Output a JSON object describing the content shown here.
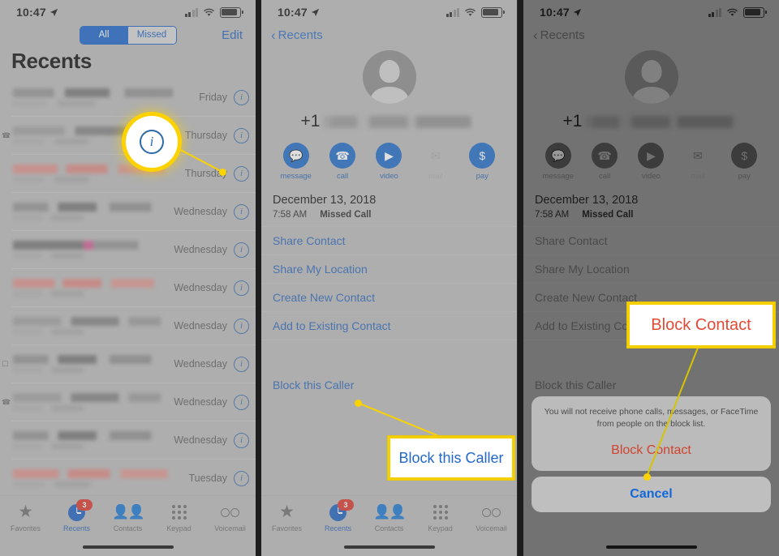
{
  "status_bar": {
    "time": "10:47",
    "location_icon": "location-arrow-icon",
    "wifi_icon": "wifi-icon",
    "battery_icon": "battery-icon",
    "signal_icon": "cellular-signal-icon"
  },
  "panel1": {
    "segmented": {
      "options": [
        "All",
        "Missed"
      ],
      "selected": "All"
    },
    "edit_label": "Edit",
    "title": "Recents",
    "rows": [
      {
        "when": "Friday",
        "icon": "",
        "style": "g1",
        "sub": true
      },
      {
        "when": "Thursday",
        "icon": "phone-outgoing-icon",
        "style": "g2",
        "sub": true
      },
      {
        "when": "Thursday",
        "icon": "",
        "style": "gr",
        "sub": true
      },
      {
        "when": "Wednesday",
        "icon": "",
        "style": "g1",
        "sub": true
      },
      {
        "when": "Wednesday",
        "icon": "",
        "style": "gp",
        "sub": true
      },
      {
        "when": "Wednesday",
        "icon": "",
        "style": "gr",
        "sub": true
      },
      {
        "when": "Wednesday",
        "icon": "",
        "style": "g2",
        "sub": true
      },
      {
        "when": "Wednesday",
        "icon": "video-call-icon",
        "style": "g1",
        "sub": true
      },
      {
        "when": "Wednesday",
        "icon": "phone-outgoing-icon",
        "style": "g2",
        "sub": true
      },
      {
        "when": "Wednesday",
        "icon": "",
        "style": "g1",
        "sub": true
      },
      {
        "when": "Tuesday",
        "icon": "",
        "style": "gr",
        "sub": true
      }
    ],
    "info_button_label": "i"
  },
  "tabs": [
    {
      "label": "Favorites",
      "icon": "star-icon",
      "active": false,
      "badge": ""
    },
    {
      "label": "Recents",
      "icon": "clock-icon",
      "active": true,
      "badge": "3"
    },
    {
      "label": "Contacts",
      "icon": "people-icon",
      "active": false,
      "badge": ""
    },
    {
      "label": "Keypad",
      "icon": "keypad-icon",
      "active": false,
      "badge": ""
    },
    {
      "label": "Voicemail",
      "icon": "voicemail-icon",
      "active": false,
      "badge": ""
    }
  ],
  "contact": {
    "back_label": "Recents",
    "avatar_icon": "default-avatar-icon",
    "country_code": "+1",
    "phone_number_blurred": "redacted",
    "actions": [
      {
        "label": "message",
        "icon": "message-bubble-icon",
        "disabled": false
      },
      {
        "label": "call",
        "icon": "phone-icon",
        "disabled": false
      },
      {
        "label": "video",
        "icon": "video-camera-icon",
        "disabled": false
      },
      {
        "label": "mail",
        "icon": "envelope-icon",
        "disabled": true
      },
      {
        "label": "pay",
        "icon": "dollar-sign-icon",
        "disabled": false
      }
    ],
    "call_date": "December 13, 2018",
    "call_time": "7:58 AM",
    "call_type": "Missed Call",
    "menu": [
      "Share Contact",
      "Share My Location",
      "Create New Contact",
      "Add to Existing Contact"
    ],
    "block_item": "Block this Caller"
  },
  "action_sheet": {
    "message": "You will not receive phone calls, messages, or FaceTime from people on the block list.",
    "confirm_label": "Block Contact",
    "cancel_label": "Cancel"
  },
  "callouts": {
    "block_this_caller": "Block this Caller",
    "block_contact": "Block Contact"
  },
  "colors": {
    "accent_blue": "#1d6ac4",
    "link_blue": "#2b66bb",
    "highlight_yellow": "#fbd300",
    "destructive_red": "#d0442f",
    "badge_red": "#d8382b"
  }
}
